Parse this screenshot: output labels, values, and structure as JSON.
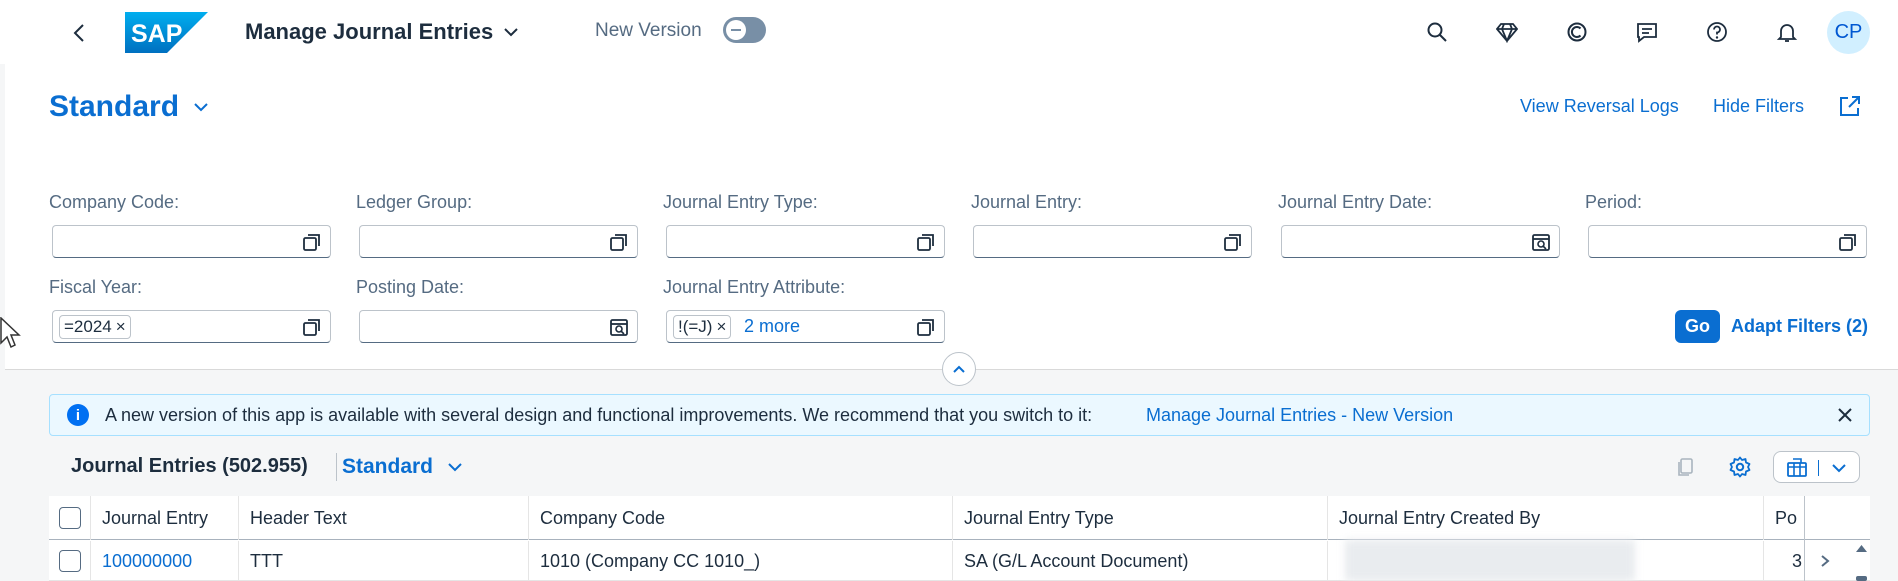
{
  "shell": {
    "app_title": "Manage Journal Entries",
    "new_version_label": "New Version",
    "new_version_on": false,
    "avatar_initials": "CP",
    "logo_text": "SAP",
    "icons": [
      "search-icon",
      "diamond-icon",
      "copilot-icon",
      "feedback-icon",
      "help-icon",
      "notifications-icon"
    ]
  },
  "header": {
    "variant": "Standard",
    "links": {
      "reversal_logs": "View Reversal Logs",
      "hide_filters": "Hide Filters"
    }
  },
  "filters": {
    "company_code": {
      "label": "Company Code:",
      "value": ""
    },
    "ledger_group": {
      "label": "Ledger Group:",
      "value": ""
    },
    "journal_entry_type": {
      "label": "Journal Entry Type:",
      "value": ""
    },
    "journal_entry": {
      "label": "Journal Entry:",
      "value": ""
    },
    "journal_entry_date": {
      "label": "Journal Entry Date:",
      "value": ""
    },
    "period": {
      "label": "Period:",
      "value": ""
    },
    "fiscal_year": {
      "label": "Fiscal Year:",
      "token": "=2024"
    },
    "posting_date": {
      "label": "Posting Date:",
      "value": ""
    },
    "journal_entry_attribute": {
      "label": "Journal Entry Attribute:",
      "token": "!(=J)",
      "more": "2 more"
    },
    "go": "Go",
    "adapt": "Adapt Filters (2)"
  },
  "message_strip": {
    "text": "A new version of this app is available with several design and functional improvements. We recommend that you switch to it:",
    "link": "Manage Journal Entries - New Version",
    "info_glyph": "i"
  },
  "table": {
    "title": "Journal Entries (502.955)",
    "variant": "Standard",
    "columns": [
      "Journal Entry",
      "Header Text",
      "Company Code",
      "Journal Entry Type",
      "Journal Entry Created By",
      "Po"
    ],
    "rows": [
      {
        "journal_entry": "100000000",
        "header_text": "TTT",
        "company_code": "1010 (Company CC 1010_)",
        "journal_entry_type": "SA (G/L Account Document)",
        "created_by": "",
        "po": "3"
      }
    ]
  },
  "colors": {
    "accent": "#0a6ed1",
    "strip_bg": "#ebf8ff",
    "toggle_off": "#788fa6"
  }
}
